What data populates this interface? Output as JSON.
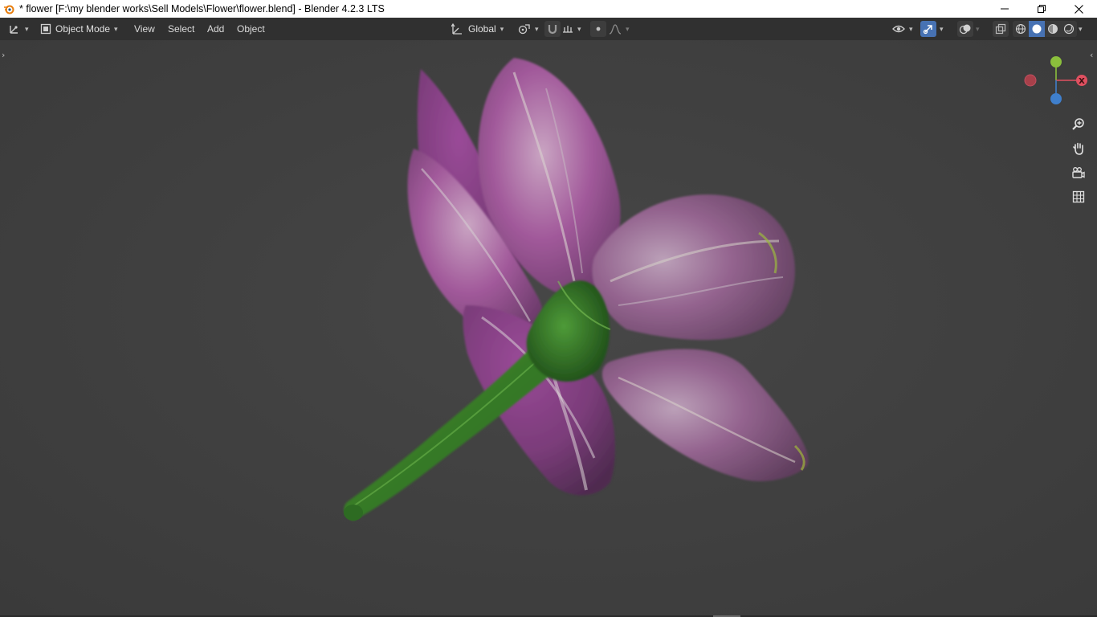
{
  "window": {
    "title": "* flower [F:\\my blender works\\Sell Models\\Flower\\flower.blend] - Blender 4.2.3 LTS",
    "app_icon": "blender-logo-icon",
    "controls": [
      "minimize-icon",
      "restore-icon",
      "close-icon"
    ]
  },
  "header": {
    "editor_type_icon": "viewport-editor-icon",
    "mode": {
      "label": "Object Mode",
      "icon": "object-mode-icon"
    },
    "menus": {
      "view": "View",
      "select": "Select",
      "add": "Add",
      "object": "Object"
    },
    "orientation": {
      "label": "Global",
      "icon": "transform-orientation-icon"
    },
    "pivot_icon": "pivot-point-icon",
    "snap_icon": "snap-magnet-icon",
    "snap_target_icon": "snap-increment-icon",
    "proportional_icon": "proportional-edit-icon",
    "falloff_icon": "falloff-curve-icon",
    "visibility_icon": "eye-visibility-icon",
    "gizmo_toggle_icon": "gizmo-toggle-icon",
    "overlay_icon": "overlays-icon",
    "xray_icon": "xray-icon",
    "shading_modes": [
      "wireframe-shading-icon",
      "solid-shading-icon",
      "material-preview-icon",
      "rendered-shading-icon"
    ],
    "active_shading": "solid-shading-icon",
    "accent_color": "#4772b3"
  },
  "viewport": {
    "background_color": "#3d3d3d",
    "object_name": "flower",
    "gizmo": {
      "x_label": "X",
      "x_color": "#e05060",
      "y_color": "#8bbf3c",
      "z_color": "#3f7fcc"
    },
    "nav_tools": [
      "zoom-icon",
      "pan-hand-icon",
      "camera-view-icon",
      "ortho-grid-icon"
    ]
  }
}
